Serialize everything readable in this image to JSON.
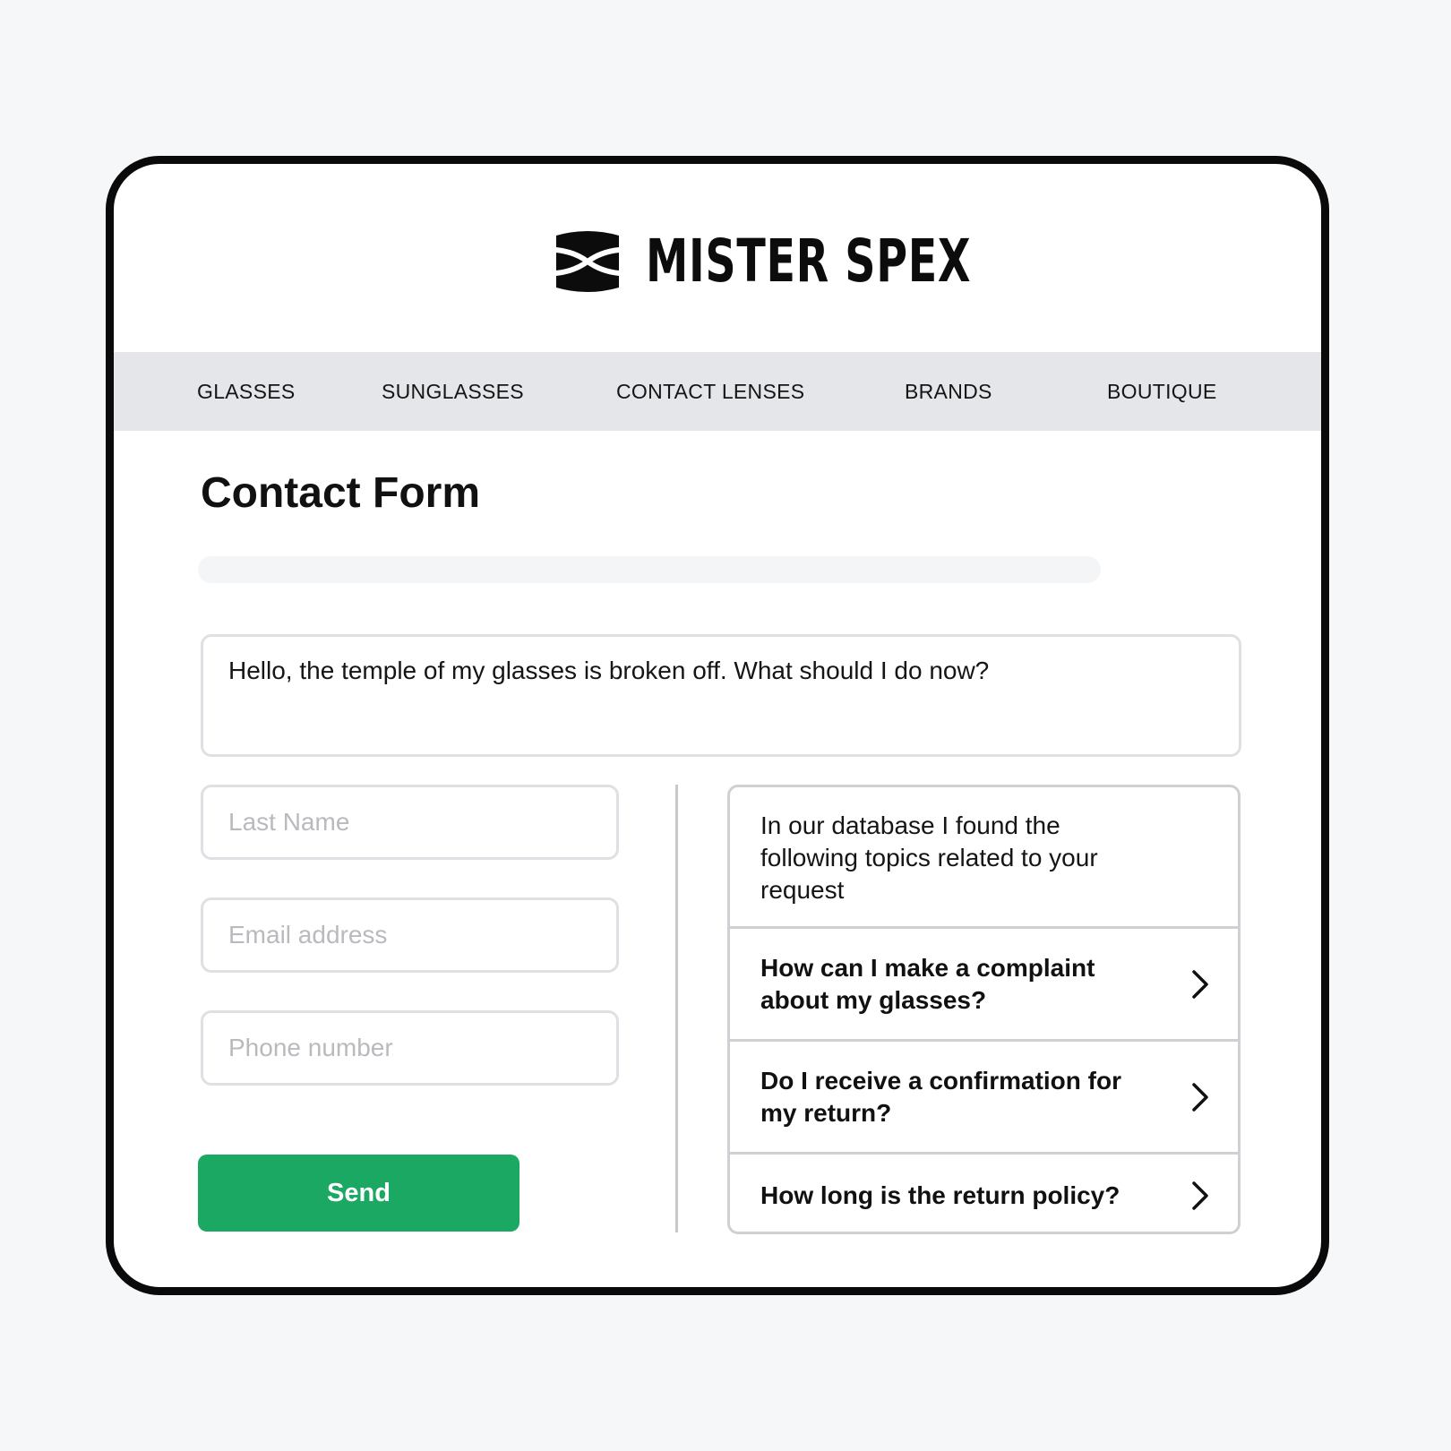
{
  "brand": {
    "name": "MISTER SPEX",
    "logo_icon": "glasses-logo-icon"
  },
  "nav": {
    "items": [
      {
        "label": "GLASSES"
      },
      {
        "label": "SUNGLASSES"
      },
      {
        "label": "CONTACT LENSES"
      },
      {
        "label": "BRANDS"
      },
      {
        "label": "BOUTIQUE"
      }
    ]
  },
  "form": {
    "title": "Contact Form",
    "message_value": "Hello, the temple of my glasses is broken off. What should I do now?",
    "last_name_placeholder": "Last Name",
    "email_placeholder": "Email address",
    "phone_placeholder": "Phone number",
    "send_label": "Send"
  },
  "suggestions": {
    "intro": "In our database I found the following topics related to your request",
    "items": [
      {
        "label": "How can I make a complaint about my glasses?",
        "icon": "chevron-right-icon"
      },
      {
        "label": "Do I receive a confirmation for my return?",
        "icon": "chevron-right-icon"
      },
      {
        "label": "How long is the return policy?",
        "icon": "chevron-right-icon"
      }
    ]
  },
  "colors": {
    "accent": "#1aa862",
    "nav_bg": "#e5e6ea",
    "frame": "#0a0a0a",
    "placeholder": "#b9babe"
  }
}
